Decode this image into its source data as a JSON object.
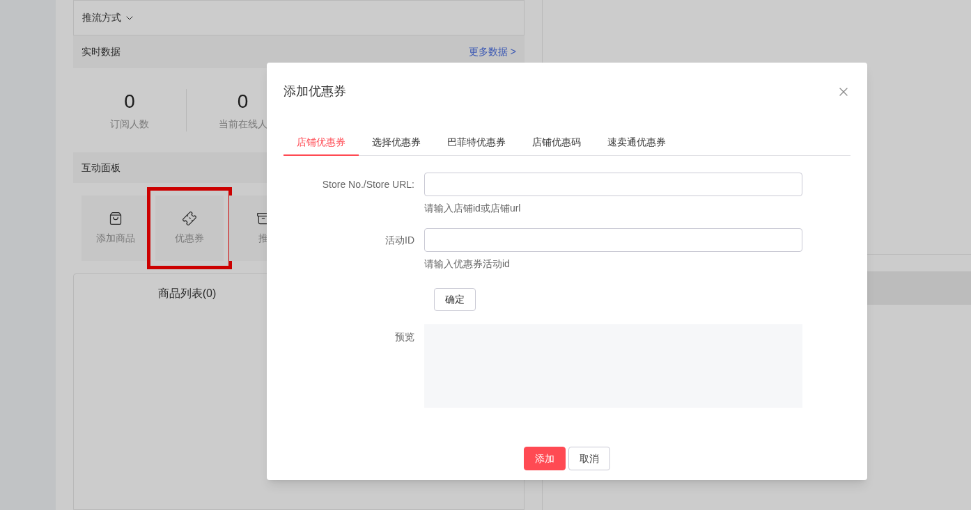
{
  "page": {
    "stream_mode": "推流方式",
    "realtime": {
      "title": "实时数据",
      "more_link": "更多数据 >"
    },
    "stats": [
      {
        "value": "0",
        "label": "订阅人数"
      },
      {
        "value": "0",
        "label": "当前在线人"
      }
    ],
    "interaction": {
      "title": "互动面板",
      "tiles": [
        {
          "label": "添加商品",
          "kind": "bag",
          "selected": false
        },
        {
          "label": "优惠券",
          "kind": "coupon",
          "selected": true
        },
        {
          "label": "推",
          "kind": "box",
          "selected": false
        }
      ]
    },
    "product_list": {
      "title": "商品列表(0)"
    }
  },
  "dialog": {
    "title": "添加优惠券",
    "tabs": [
      {
        "label": "店铺优惠券",
        "selected": true
      },
      {
        "label": "选择优惠券",
        "selected": false
      },
      {
        "label": "巴菲特优惠券",
        "selected": false
      },
      {
        "label": "店铺优惠码",
        "selected": false
      },
      {
        "label": "速卖通优惠券",
        "selected": false
      }
    ],
    "fields": [
      {
        "label": "Store No./Store URL:",
        "hint": "请输入店铺id或店铺url"
      },
      {
        "label": "活动ID",
        "hint": "请输入优惠券活动id"
      }
    ],
    "confirm_button": "确定",
    "preview_label": "预览",
    "buttons": [
      {
        "label": "添加",
        "kind": "primary"
      },
      {
        "label": "取消",
        "kind": "default"
      }
    ]
  }
}
